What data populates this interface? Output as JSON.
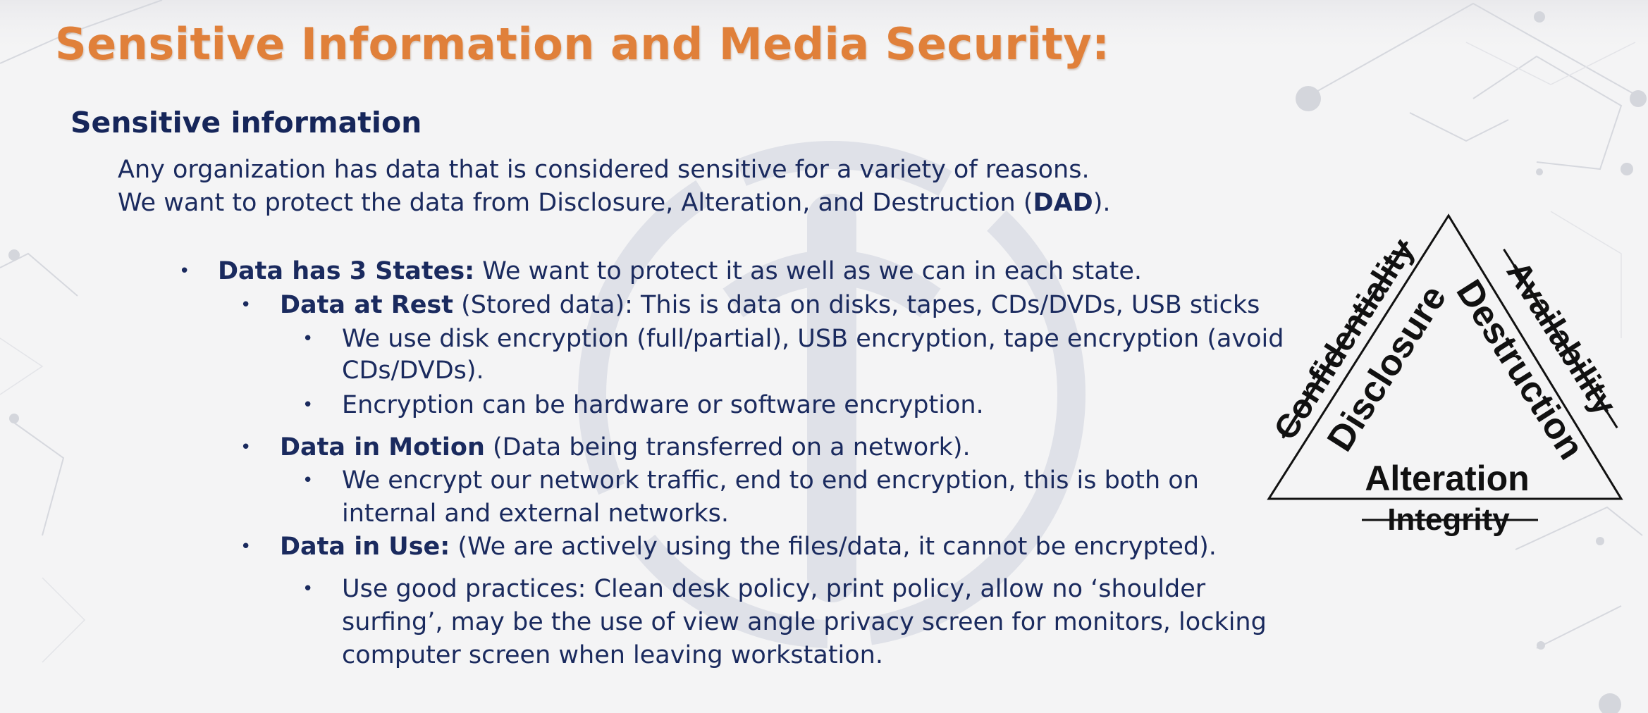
{
  "slide": {
    "title": "Sensitive Information and Media Security:",
    "subtitle": "Sensitive information",
    "intro": [
      "Any organization has data that is considered sensitive for a variety of reasons.",
      "We want to protect the data from Disclosure, Alteration, and Destruction (",
      "DAD",
      ")."
    ],
    "states": {
      "heading_bold": "Data has 3 States:",
      "heading_text": " We want to protect it as well as we can in each state.",
      "rest": {
        "bold": "Data at Rest",
        "text": " (Stored data): This is data on disks, tapes, CDs/DVDs, USB sticks",
        "subs": [
          [
            "We use disk encryption (full/partial), USB encryption, tape encryption (avoid",
            "CDs/DVDs)."
          ],
          [
            "Encryption can be hardware or software encryption."
          ]
        ]
      },
      "motion": {
        "bold": "Data in Motion",
        "text": " (Data being transferred on a network).",
        "subs": [
          [
            "We encrypt our network traffic, end to end encryption, this is both on",
            "internal and external networks."
          ]
        ]
      },
      "use": {
        "bold": "Data in Use:",
        "text": " (We are actively using the files/data, it cannot be encrypted).",
        "subs": [
          [
            "Use good practices: Clean desk policy, print policy, allow no ‘shoulder",
            "surfing’, may be the use of view angle privacy screen for monitors, locking",
            "computer screen when leaving workstation."
          ]
        ]
      }
    },
    "bullet_char": "•"
  },
  "diagram": {
    "left_struck": "Confidentiality",
    "left": "Disclosure",
    "right_struck": "Availability",
    "right": "Destruction",
    "bottom": "Alteration",
    "bottom_struck": "Integrity"
  },
  "colors": {
    "title": "#e0803a",
    "text": "#1a2a5e",
    "diagram": "#111111"
  }
}
